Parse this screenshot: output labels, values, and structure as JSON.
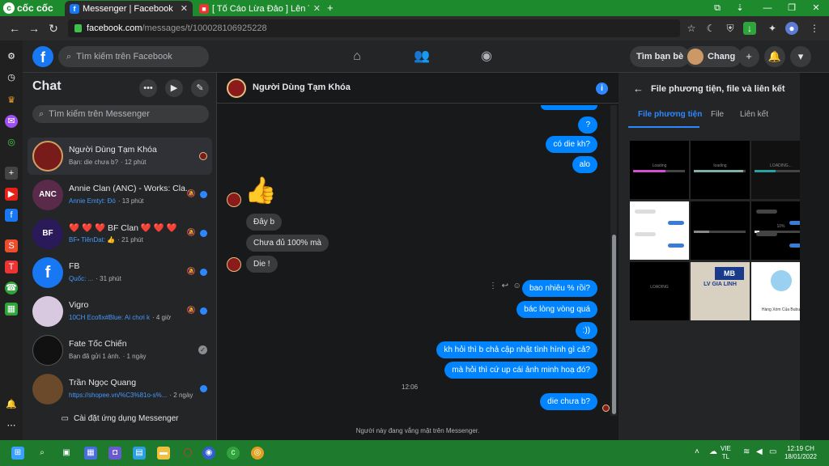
{
  "browser": {
    "brand": "cốc cốc",
    "tabs": [
      {
        "title": "Messenger | Facebook",
        "active": true
      },
      {
        "title": "[ Tố Cáo Lừa Đảo ] Lên Trung...",
        "active": false
      }
    ],
    "new_tab": "+",
    "url_domain": "facebook.com",
    "url_path": "/messages/t/100028106925228"
  },
  "fb": {
    "search_placeholder": "Tìm kiếm trên Facebook",
    "find_friends": "Tìm bạn bè",
    "user_name": "Chang"
  },
  "chat_list": {
    "title": "Chat",
    "search_placeholder": "Tìm kiếm trên Messenger",
    "conversations": [
      {
        "name": "Người Dùng Tạm Khóa",
        "preview": "Bạn: die chưa b?",
        "time": "· 12 phút",
        "color": "#7a1b1b"
      },
      {
        "name": "Annie Clan (ANC) - Works: Cla...",
        "preview": "Annie Emtyt: Đó",
        "time": "· 13 phút",
        "color": "#5a2a4a"
      },
      {
        "name": "❤️ ❤️ ❤️ BF Clan ❤️ ❤️ ❤️",
        "preview": "BF• TiênDat: 👍",
        "time": "· 21 phút",
        "color": "#2a1a5a"
      },
      {
        "name": "FB",
        "preview": "Quốc: ...",
        "time": "· 31 phút",
        "color": "#1877f2"
      },
      {
        "name": "Vigro",
        "preview": "10CH Ecofix#Blue: Ai chơi k",
        "time": "· 4 giờ",
        "color": "#d8c8e0"
      },
      {
        "name": "Fate Tốc Chiến",
        "preview": "Bạn đã gửi 1 ảnh.",
        "time": "· 1 ngày",
        "color": "#111111"
      },
      {
        "name": "Trần Ngọc Quang",
        "preview": "https://shopee.vn/%C3%81o-s%...",
        "time": "· 2 ngày",
        "color": "#6a4a2a"
      }
    ],
    "install_label": "Cài đặt ứng dụng Messenger"
  },
  "conversation": {
    "name": "Người Dùng Tạm Khóa",
    "messages": [
      {
        "text": "?",
        "dir": "out"
      },
      {
        "text": "có die kh?",
        "dir": "out"
      },
      {
        "text": "alo",
        "dir": "out"
      },
      {
        "text": "👍",
        "dir": "in"
      },
      {
        "text": "Đây b",
        "dir": "in"
      },
      {
        "text": "Chưa đủ 100% mà",
        "dir": "in"
      },
      {
        "text": "Die !",
        "dir": "in"
      },
      {
        "text": "bao nhiêu % rồi?",
        "dir": "out"
      },
      {
        "text": "bác lòng vòng quá",
        "dir": "out"
      },
      {
        "text": ":))",
        "dir": "out"
      },
      {
        "text": "kh hỏi thì b chả cập nhật tình hình gì cả?",
        "dir": "out"
      },
      {
        "text": "mà hỏi thì cứ up cái ảnh minh hoạ đó?",
        "dir": "out"
      },
      {
        "text": "die chưa b?",
        "dir": "out"
      }
    ],
    "timestamp": "12:06",
    "footer_note": "Người này đang vắng mặt trên Messenger."
  },
  "media_panel": {
    "title": "File phương tiện, file và liên kết",
    "tabs": [
      "File phương tiện",
      "File",
      "Liên kết"
    ],
    "thumb_labels": [
      "Loading",
      "loading",
      "LOADING...",
      "",
      "",
      "10%",
      "LOADING",
      "LV GIA LINH",
      "Hàng Xóm Của Bubu"
    ],
    "progress": [
      0.62,
      0.95,
      0.4,
      0,
      0.3,
      0.1,
      0,
      0,
      0
    ]
  },
  "taskbar": {
    "lang": "VIE",
    "lang2": "TL",
    "time": "12:19 CH",
    "date": "18/01/2022"
  }
}
